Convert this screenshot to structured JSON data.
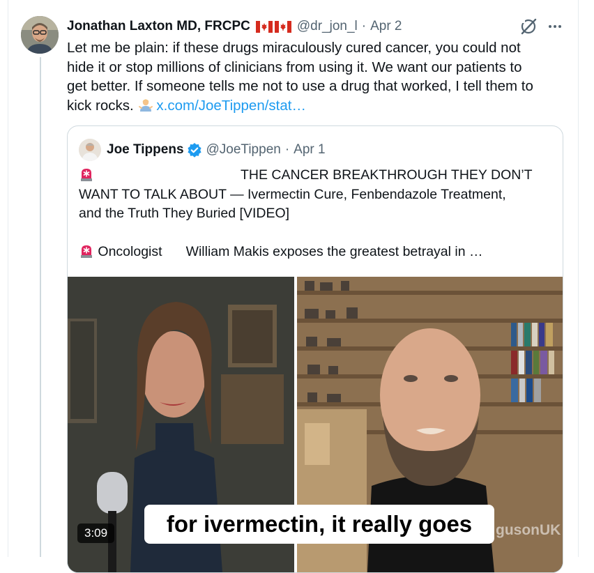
{
  "main_tweet": {
    "author_name": "Jonathan Laxton MD, FRCPC",
    "handle": "@dr_jon_l",
    "separator": "·",
    "date": "Apr 2",
    "text_lines": [
      "Let me be plain: if these drugs miraculously cured cancer, you could not",
      "hide it or stop millions of clinicians from using it.  We want our patients to",
      "get better.  If someone tells me not to use a drug that worked, I tell them to",
      "kick rocks."
    ],
    "link_text": "x.com/JoeTippen/stat…",
    "icons": [
      "canada-flag-icon",
      "grok-icon",
      "more-icon",
      "person-shrugging-emoji"
    ]
  },
  "quote_tweet": {
    "author_name": "Joe Tippens",
    "handle": "@JoeTippen",
    "separator": "·",
    "date": "Apr 1",
    "text_line1": "THE CANCER BREAKTHROUGH THEY DON’T",
    "text_line2": "WANT TO TALK ABOUT — Ivermectin Cure, Fenbendazole Treatment,",
    "text_line3": "and the Truth They Buried [VIDEO]",
    "text_line4_a": "Oncologist",
    "text_line4_b": "William Makis exposes the greatest betrayal in …",
    "icons": [
      "verified-badge-icon",
      "siren-emoji-icon"
    ]
  },
  "video": {
    "duration": "3:09",
    "caption": "for ivermectin, it really goes",
    "watermark": "gusonUK"
  },
  "colors": {
    "link": "#1d9bf0",
    "muted": "#536471",
    "verified": "#1d9bf0",
    "siren": "#e0245e"
  }
}
